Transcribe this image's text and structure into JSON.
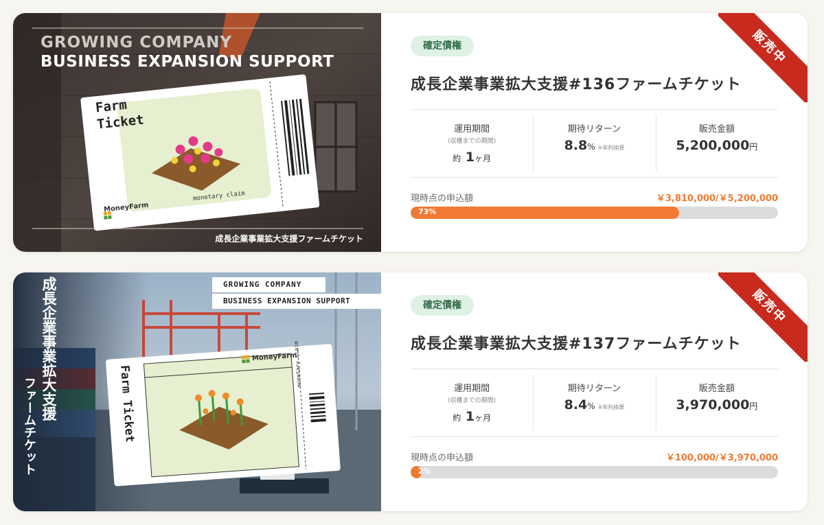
{
  "colors": {
    "accent": "#f07a33",
    "ribbon": "#c82a1e",
    "badge_bg": "#dff0e5"
  },
  "cards": [
    {
      "ribbon": "販売中",
      "badge": "確定債権",
      "title": "成長企業事業拡大支援#136ファームチケット",
      "thumb": {
        "line1": "GROWING COMPANY",
        "line2": "BUSINESS EXPANSION SUPPORT",
        "ticket_title_1": "Farm",
        "ticket_title_2": "Ticket",
        "brand": "MoneyFarm",
        "claim": "monetary claim",
        "caption": "成長企業事業拡大支援ファームチケット"
      },
      "stats": {
        "period_label": "運用期間",
        "period_sub": "(収穫までの期間)",
        "period_prefix": "約",
        "period_value": "1",
        "period_unit": "ヶ月",
        "return_label": "期待リターン",
        "return_value": "8.8",
        "return_unit": "%",
        "return_note": "※年利換算",
        "amount_label": "販売金額",
        "amount_value": "5,200,000",
        "amount_unit": "円"
      },
      "progress_label": "現時点の申込額",
      "progress_text": "￥3,810,000/￥5,200,000",
      "progress_percent": 73,
      "progress_percent_label": "73%"
    },
    {
      "ribbon": "販売中",
      "badge": "確定債権",
      "title": "成長企業事業拡大支援#137ファームチケット",
      "thumb": {
        "line1": "GROWING COMPANY",
        "line2": "BUSINESS EXPANSION SUPPORT",
        "vertical_1": "成長企業事業拡大支援",
        "vertical_2": "ファームチケット",
        "ticket_title": "Farm Ticket",
        "brand": "MoneyFarm",
        "claim": "monetary claim"
      },
      "stats": {
        "period_label": "運用期間",
        "period_sub": "(収穫までの期間)",
        "period_prefix": "約",
        "period_value": "1",
        "period_unit": "ヶ月",
        "return_label": "期待リターン",
        "return_value": "8.4",
        "return_unit": "%",
        "return_note": "※年利換算",
        "amount_label": "販売金額",
        "amount_value": "3,970,000",
        "amount_unit": "円"
      },
      "progress_label": "現時点の申込額",
      "progress_text": "￥100,000/￥3,970,000",
      "progress_percent": 2,
      "progress_percent_label": "2%"
    }
  ]
}
